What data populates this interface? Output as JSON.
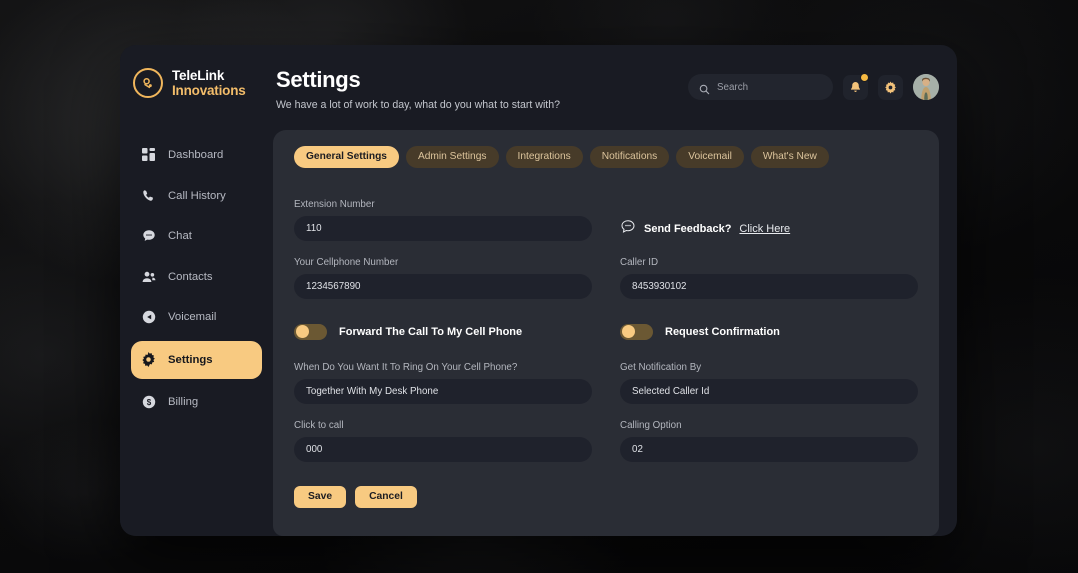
{
  "brand": {
    "line1": "TeleLink",
    "line2": "Innovations",
    "logo_icon": "circular-ring-logo-icon"
  },
  "sidebar": {
    "items": [
      {
        "label": "Dashboard",
        "icon": "grid-icon",
        "active": false
      },
      {
        "label": "Call History",
        "icon": "phone-icon",
        "active": false
      },
      {
        "label": "Chat",
        "icon": "chat-icon",
        "active": false
      },
      {
        "label": "Contacts",
        "icon": "contacts-icon",
        "active": false
      },
      {
        "label": "Voicemail",
        "icon": "voicemail-icon",
        "active": false
      },
      {
        "label": "Settings",
        "icon": "gear-icon",
        "active": true
      },
      {
        "label": "Billing",
        "icon": "dollar-icon",
        "active": false
      }
    ]
  },
  "header": {
    "title": "Settings",
    "subtitle": "We have a lot of work to day, what do you what to start with?",
    "search": {
      "placeholder": "Search",
      "value": "",
      "icon": "search-icon"
    },
    "notification_icon": "bell-icon",
    "notification_badge": true,
    "settings_icon": "gear-icon",
    "avatar_icon": "user-avatar"
  },
  "tabs": [
    {
      "label": "General Settings",
      "active": true
    },
    {
      "label": "Admin Settings",
      "active": false
    },
    {
      "label": "Integrations",
      "active": false
    },
    {
      "label": "Notifications",
      "active": false
    },
    {
      "label": "Voicemail",
      "active": false
    },
    {
      "label": "What's New",
      "active": false
    }
  ],
  "form": {
    "extension_number": {
      "label": "Extension Number",
      "value": "110"
    },
    "cellphone_number": {
      "label": "Your Cellphone Number",
      "value": "1234567890"
    },
    "caller_id": {
      "label": "Caller ID",
      "value": "8453930102"
    },
    "ring_when": {
      "label": "When Do You Want It To Ring On Your Cell Phone?",
      "value": "Together With My Desk Phone"
    },
    "notification_by": {
      "label": "Get Notification By",
      "value": "Selected Caller Id"
    },
    "click_to_call": {
      "label": "Click to call",
      "value": "000"
    },
    "calling_option": {
      "label": "Calling Option",
      "value": "02"
    }
  },
  "feedback": {
    "icon": "speech-bubble-icon",
    "text": "Send Feedback?",
    "link": "Click Here"
  },
  "toggles": [
    {
      "label": "Forward The Call To My Cell Phone",
      "on": false
    },
    {
      "label": "Request Confirmation",
      "on": false
    }
  ],
  "actions": {
    "save_label": "Save",
    "cancel_label": "Cancel"
  },
  "colors": {
    "accent": "#f8ca81",
    "window_bg": "#191b23",
    "card_bg": "#2a2d35",
    "input_bg": "#1f222c",
    "tab_inactive_bg": "#473b29",
    "badge": "#f5b942"
  }
}
